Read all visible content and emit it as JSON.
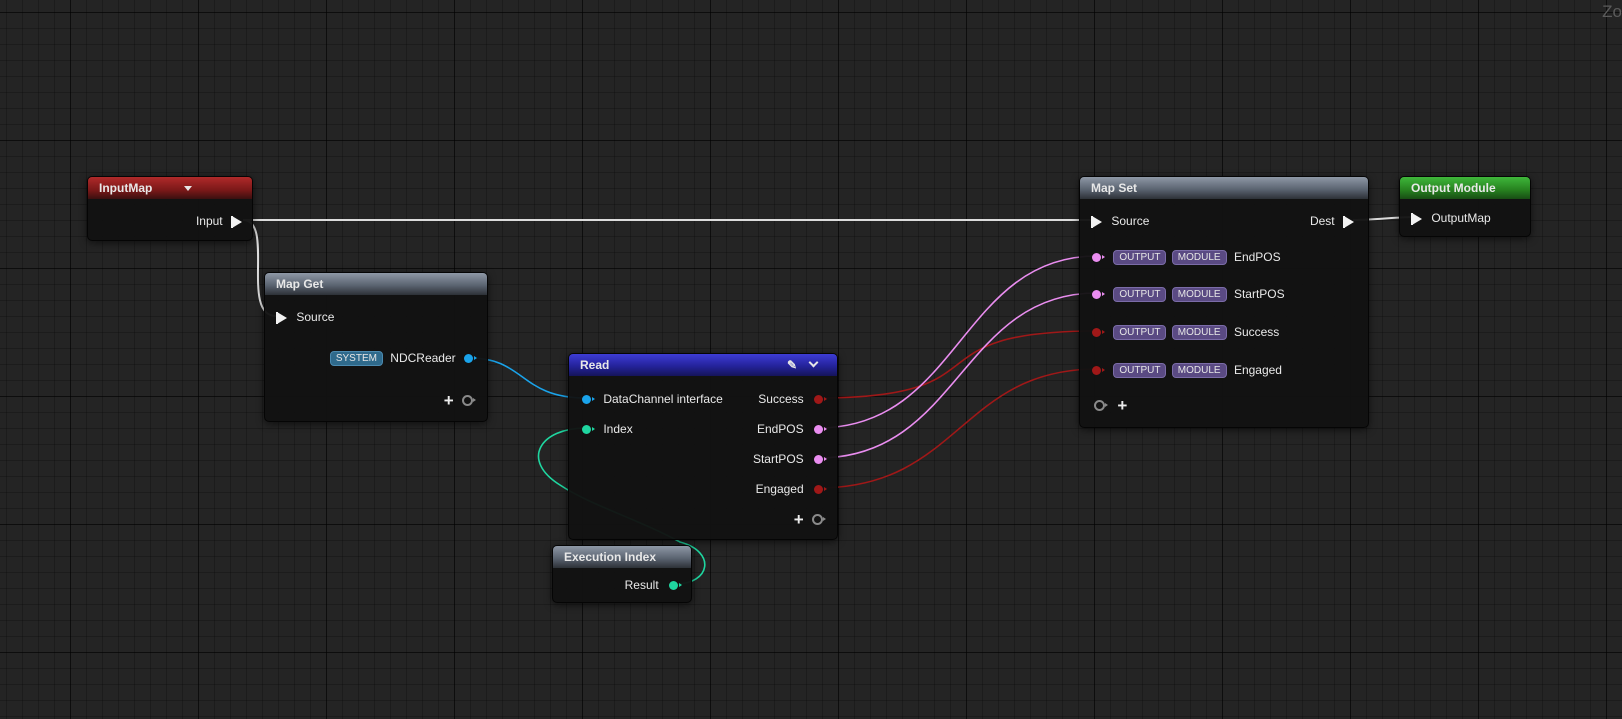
{
  "canvas": {
    "zoom_label": "Zo"
  },
  "colors": {
    "exec": "#f2f2f2",
    "vector": "#ea8df0",
    "bool": "#a01818",
    "interface": "#1aa3ea",
    "int": "#1fd6a0",
    "wire_exec": "#dcdcdc"
  },
  "nodes": {
    "input_map": {
      "title": "InputMap",
      "output_pin": "Input"
    },
    "map_get": {
      "title": "Map Get",
      "input_pin": "Source",
      "output_pin": {
        "tag": "SYSTEM",
        "label": "NDCReader"
      }
    },
    "read": {
      "title": "Read",
      "inputs": [
        "DataChannel interface",
        "Index"
      ],
      "outputs": [
        "Success",
        "EndPOS",
        "StartPOS",
        "Engaged"
      ]
    },
    "execution_index": {
      "title": "Execution Index",
      "output_pin": "Result"
    },
    "map_set": {
      "title": "Map Set",
      "input_pin": "Source",
      "output_pin": "Dest",
      "params": [
        {
          "tag1": "OUTPUT",
          "tag2": "MODULE",
          "label": "EndPOS",
          "type": "vector"
        },
        {
          "tag1": "OUTPUT",
          "tag2": "MODULE",
          "label": "StartPOS",
          "type": "vector"
        },
        {
          "tag1": "OUTPUT",
          "tag2": "MODULE",
          "label": "Success",
          "type": "bool"
        },
        {
          "tag1": "OUTPUT",
          "tag2": "MODULE",
          "label": "Engaged",
          "type": "bool"
        }
      ]
    },
    "output_module": {
      "title": "Output Module",
      "input_pin": "OutputMap"
    }
  }
}
